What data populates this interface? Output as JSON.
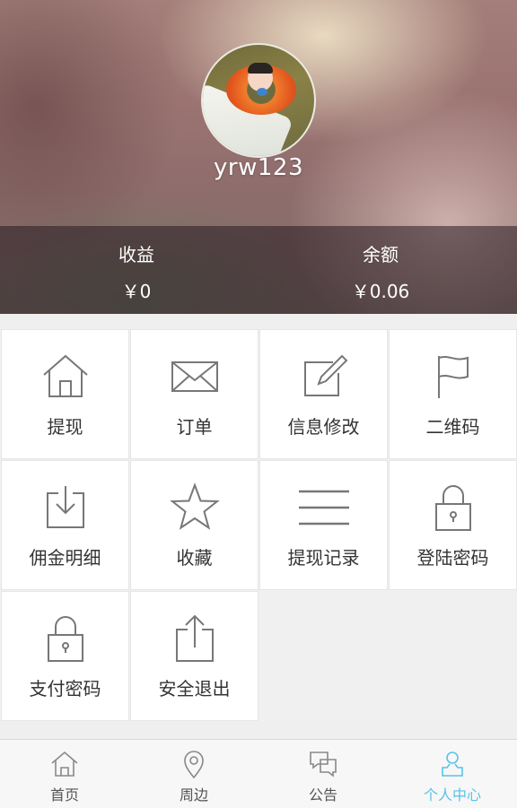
{
  "profile": {
    "username": "yrw123",
    "income_label": "收益",
    "income_value": "￥0",
    "balance_label": "余额",
    "balance_value": "￥0.06"
  },
  "menu": [
    {
      "label": "提现",
      "icon": "home-icon"
    },
    {
      "label": "订单",
      "icon": "envelope-icon"
    },
    {
      "label": "信息修改",
      "icon": "edit-icon"
    },
    {
      "label": "二维码",
      "icon": "flag-icon"
    },
    {
      "label": "佣金明细",
      "icon": "download-icon"
    },
    {
      "label": "收藏",
      "icon": "star-icon"
    },
    {
      "label": "提现记录",
      "icon": "list-icon"
    },
    {
      "label": "登陆密码",
      "icon": "lock-icon"
    },
    {
      "label": "支付密码",
      "icon": "lock-icon"
    },
    {
      "label": "安全退出",
      "icon": "share-icon"
    }
  ],
  "tabbar": [
    {
      "label": "首页",
      "icon": "home-icon"
    },
    {
      "label": "周边",
      "icon": "location-pin-icon"
    },
    {
      "label": "公告",
      "icon": "chat-bubbles-icon"
    },
    {
      "label": "个人中心",
      "icon": "user-icon",
      "active": true
    }
  ],
  "colors": {
    "accent": "#56c3e8",
    "icon_gray": "#777777",
    "text": "#333333"
  }
}
